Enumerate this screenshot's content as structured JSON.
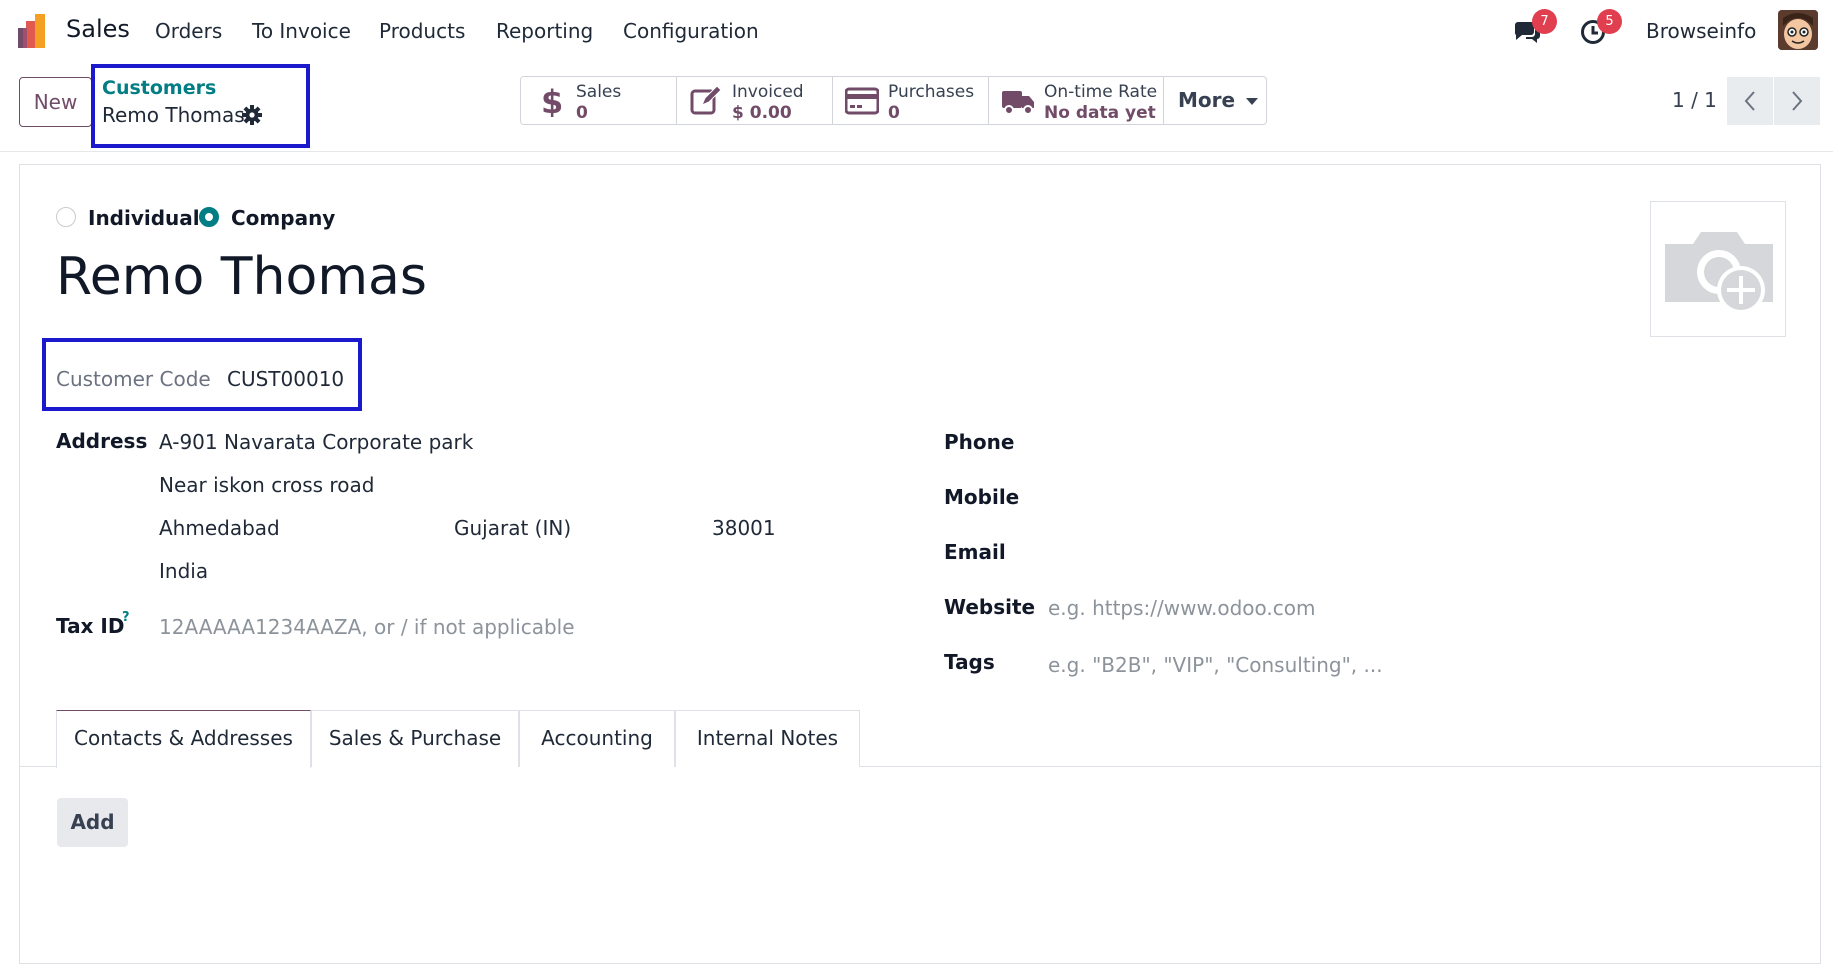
{
  "topnav": {
    "app_name": "Sales",
    "menu": [
      "Orders",
      "To Invoice",
      "Products",
      "Reporting",
      "Configuration"
    ],
    "messages_badge": "7",
    "activities_badge": "5",
    "user_name": "Browseinfo"
  },
  "control_panel": {
    "new_label": "New",
    "breadcrumb_parent": "Customers",
    "breadcrumb_current": "Remo Thomas",
    "smart_buttons": [
      {
        "label": "Sales",
        "value": "0",
        "icon": "dollar-icon"
      },
      {
        "label": "Invoiced",
        "value": "$ 0.00",
        "icon": "edit-icon"
      },
      {
        "label": "Purchases",
        "value": "0",
        "icon": "credit-card-icon"
      },
      {
        "label": "On-time Rate",
        "value": "No data yet",
        "icon": "truck-icon"
      }
    ],
    "more_label": "More",
    "pager": "1 / 1"
  },
  "form": {
    "type_options": [
      "Individual",
      "Company"
    ],
    "selected_type": "Company",
    "name": "Remo Thomas",
    "customer_code_label": "Customer Code",
    "customer_code": "CUST00010",
    "address_label": "Address",
    "street": "A-901 Navarata Corporate park",
    "street2": "Near iskon cross road",
    "city": "Ahmedabad",
    "state": "Gujarat (IN)",
    "zip": "38001",
    "country": "India",
    "tax_id_label": "Tax ID",
    "tax_id_help": "?",
    "tax_id_placeholder": "12AAAAA1234AAZA, or / if not applicable",
    "phone_label": "Phone",
    "mobile_label": "Mobile",
    "email_label": "Email",
    "website_label": "Website",
    "website_placeholder": "e.g. https://www.odoo.com",
    "tags_label": "Tags",
    "tags_placeholder": "e.g. \"B2B\", \"VIP\", \"Consulting\", ..."
  },
  "tabs": [
    "Contacts & Addresses",
    "Sales & Purchase",
    "Accounting",
    "Internal Notes"
  ],
  "add_label": "Add",
  "colors": {
    "brand": "#714b67",
    "accent": "#017e84",
    "highlight_box": "#1a1acc",
    "badge": "#e03f4f"
  }
}
